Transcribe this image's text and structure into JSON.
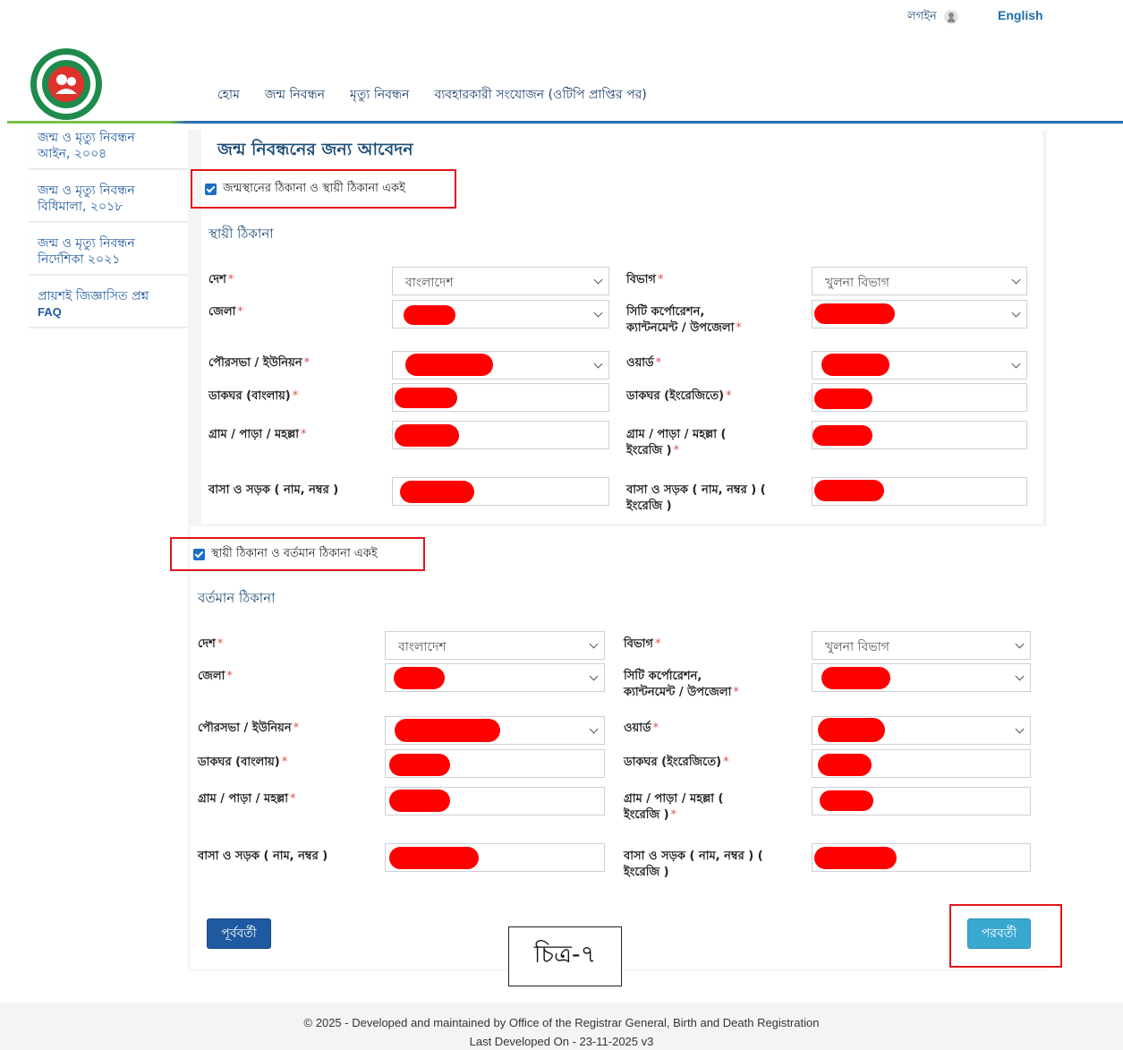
{
  "header": {
    "login_label": "লগইন",
    "language_label": "English",
    "nav": [
      "হোম",
      "জন্ম নিবন্ধন",
      "মৃত্যু নিবন্ধন",
      "ব্যবহারকারী সংযোজন (ওটিপি প্রাপ্তির পর)"
    ]
  },
  "sidebar": {
    "items": [
      {
        "line1": "জন্ম ও মৃত্যু নিবন্ধন",
        "line2": "আইন, ২০০৪"
      },
      {
        "line1": "জন্ম ও মৃত্যু নিবন্ধন",
        "line2": "বিধিমালা, ২০১৮"
      },
      {
        "line1": "জন্ম ও মৃত্যু নিবন্ধন",
        "line2": "নির্দেশিকা ২০২১"
      },
      {
        "line1": "প্রায়শই জিজ্ঞাসিত প্রশ্ন",
        "line2": "FAQ"
      }
    ]
  },
  "form": {
    "title": "জন্ম নিবন্ধনের জন্য আবেদন",
    "checkbox1_label": "জন্মস্থানের ঠিকানা ও স্থায়ী ঠিকানা একই",
    "checkbox1_checked": true,
    "permanent_heading": "স্থায়ী ঠিকানা",
    "checkbox2_label": "স্থায়ী ঠিকানা ও বর্তমান ঠিকানা একই",
    "checkbox2_checked": true,
    "present_heading": "বর্তমান ঠিকানা",
    "labels": {
      "country": "দেশ",
      "division": "বিভাগ",
      "district": "জেলা",
      "city_line1": "সিটি কর্পোরেশন,",
      "city_line2": "ক্যান্টনমেন্ট / উপজেলা",
      "union": "পৌরসভা / ইউনিয়ন",
      "ward": "ওয়ার্ড",
      "post_bn": "ডাকঘর (বাংলায়)",
      "post_en": "ডাকঘর (ইংরেজিতে)",
      "village_bn": "গ্রাম / পাড়া / মহল্লা",
      "village_en_line1": "গ্রাম / পাড়া / মহল্লা (",
      "village_en_line2": "ইংরেজি )",
      "house_bn": "বাসা ও সড়ক ( নাম, নম্বর )",
      "house_en_line1": "বাসা ও সড়ক ( নাম, নম্বর ) (",
      "house_en_line2": "ইংরেজি )"
    },
    "values": {
      "country": "বাংলাদেশ",
      "division": "খুলনা বিভাগ"
    },
    "required_mark": "*",
    "prev_button": "পূর্ববর্তী",
    "next_button": "পরবর্তী"
  },
  "figure_label": "চিত্র-৭",
  "footer": {
    "line1": "© 2025 - Developed and maintained by Office of the Registrar General, Birth and Death Registration",
    "line2": "Last Developed On - 23-11-2025 v3"
  }
}
